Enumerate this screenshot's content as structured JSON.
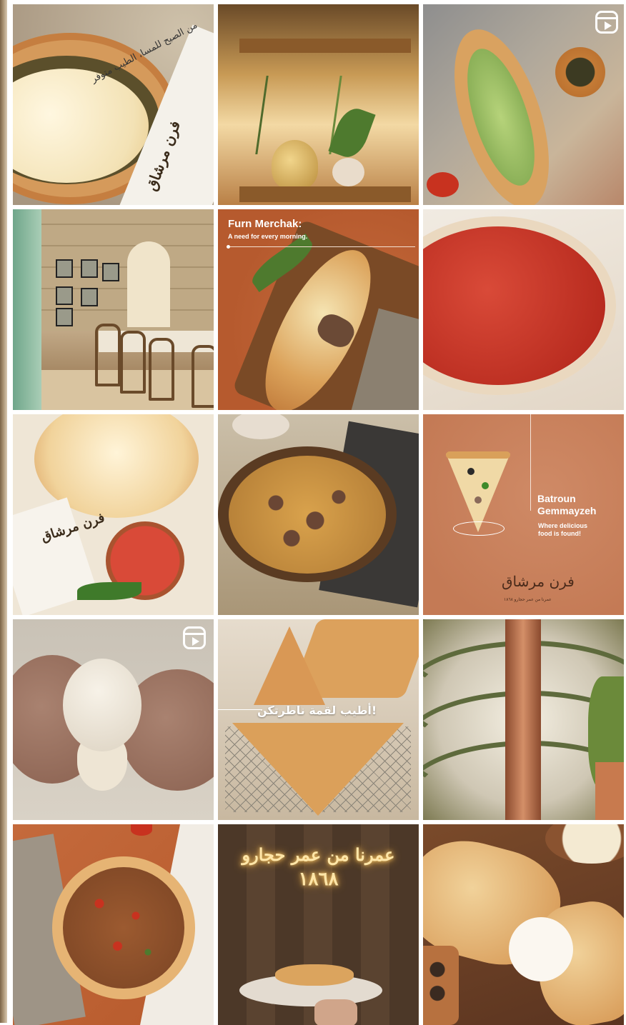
{
  "posts": [
    {
      "id": "post-1",
      "arabic_caption": "من الصبح للمسا، الطيب متوفر",
      "arabic_logo": "فرن مرشاق"
    },
    {
      "id": "post-2"
    },
    {
      "id": "post-3",
      "badge": "reel-icon"
    },
    {
      "id": "post-4"
    },
    {
      "id": "post-5",
      "title": "Furn Merchak:",
      "subtitle": "A need for every morning."
    },
    {
      "id": "post-6"
    },
    {
      "id": "post-7",
      "arabic_logo": "فرن مرشاق"
    },
    {
      "id": "post-8"
    },
    {
      "id": "post-9",
      "city_1": "Batroun",
      "city_2": "Gemmayzeh",
      "tagline_1": "Where delicious",
      "tagline_2": "food is found!",
      "arabic_logo": "فرن مرشاق",
      "logo_sub": "عمرنا من عمر حجارو ١٨٦٨"
    },
    {
      "id": "post-10",
      "badge": "reel-icon"
    },
    {
      "id": "post-11",
      "arabic_banner": "أطيب لقمة ناطرتكن!"
    },
    {
      "id": "post-12"
    },
    {
      "id": "post-13"
    },
    {
      "id": "post-14",
      "neon_line_1": "عمرنا من عمر حجارو",
      "neon_line_2": "١٨٦٨"
    },
    {
      "id": "post-15"
    }
  ],
  "colors": {
    "brand_terracotta": "#c46a3c",
    "frame_gold": "#a99273"
  }
}
